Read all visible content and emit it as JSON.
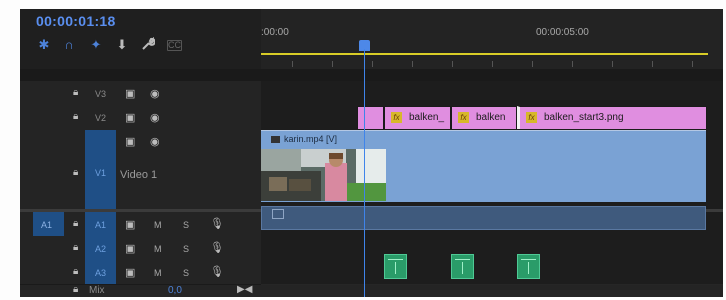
{
  "header": {
    "timecode": "00:00:01:18",
    "ruler_labels": [
      ":00:00",
      "00:00:05:00"
    ],
    "tools": [
      {
        "name": "snap-icon",
        "glyph": "✱"
      },
      {
        "name": "magnet-icon",
        "glyph": "∩"
      },
      {
        "name": "linked-selection-icon",
        "glyph": "✦"
      },
      {
        "name": "marker-icon",
        "glyph": "▼"
      },
      {
        "name": "wrench-icon",
        "glyph": "🔧"
      },
      {
        "name": "captions-icon",
        "glyph": "CC"
      }
    ]
  },
  "tracks": {
    "video": [
      {
        "id": "V3",
        "name": ""
      },
      {
        "id": "V2",
        "name": ""
      },
      {
        "id": "V1",
        "name": "Video 1"
      }
    ],
    "audio": [
      {
        "id": "A1",
        "source": "A1",
        "mute": "M",
        "solo": "S"
      },
      {
        "id": "A2",
        "mute": "M",
        "solo": "S"
      },
      {
        "id": "A3",
        "mute": "M",
        "solo": "S"
      }
    ],
    "mix": {
      "label": "Mix",
      "value": "0,0"
    }
  },
  "clips": {
    "v2": [
      {
        "label": ""
      },
      {
        "label": "balken_"
      },
      {
        "label": "balken"
      },
      {
        "label": "balken_start3.png"
      }
    ],
    "v1": {
      "label": "karin.mp4 [V]"
    }
  },
  "colors": {
    "accent": "#4d82d8",
    "playhead": "#3f84ea",
    "work_area": "#d8cc27",
    "v2_clip": "#e08ee0",
    "v1_clip": "#7aa2d4",
    "audio_clip": "#3f5a7d",
    "adjust_clip": "#2a9c69"
  }
}
